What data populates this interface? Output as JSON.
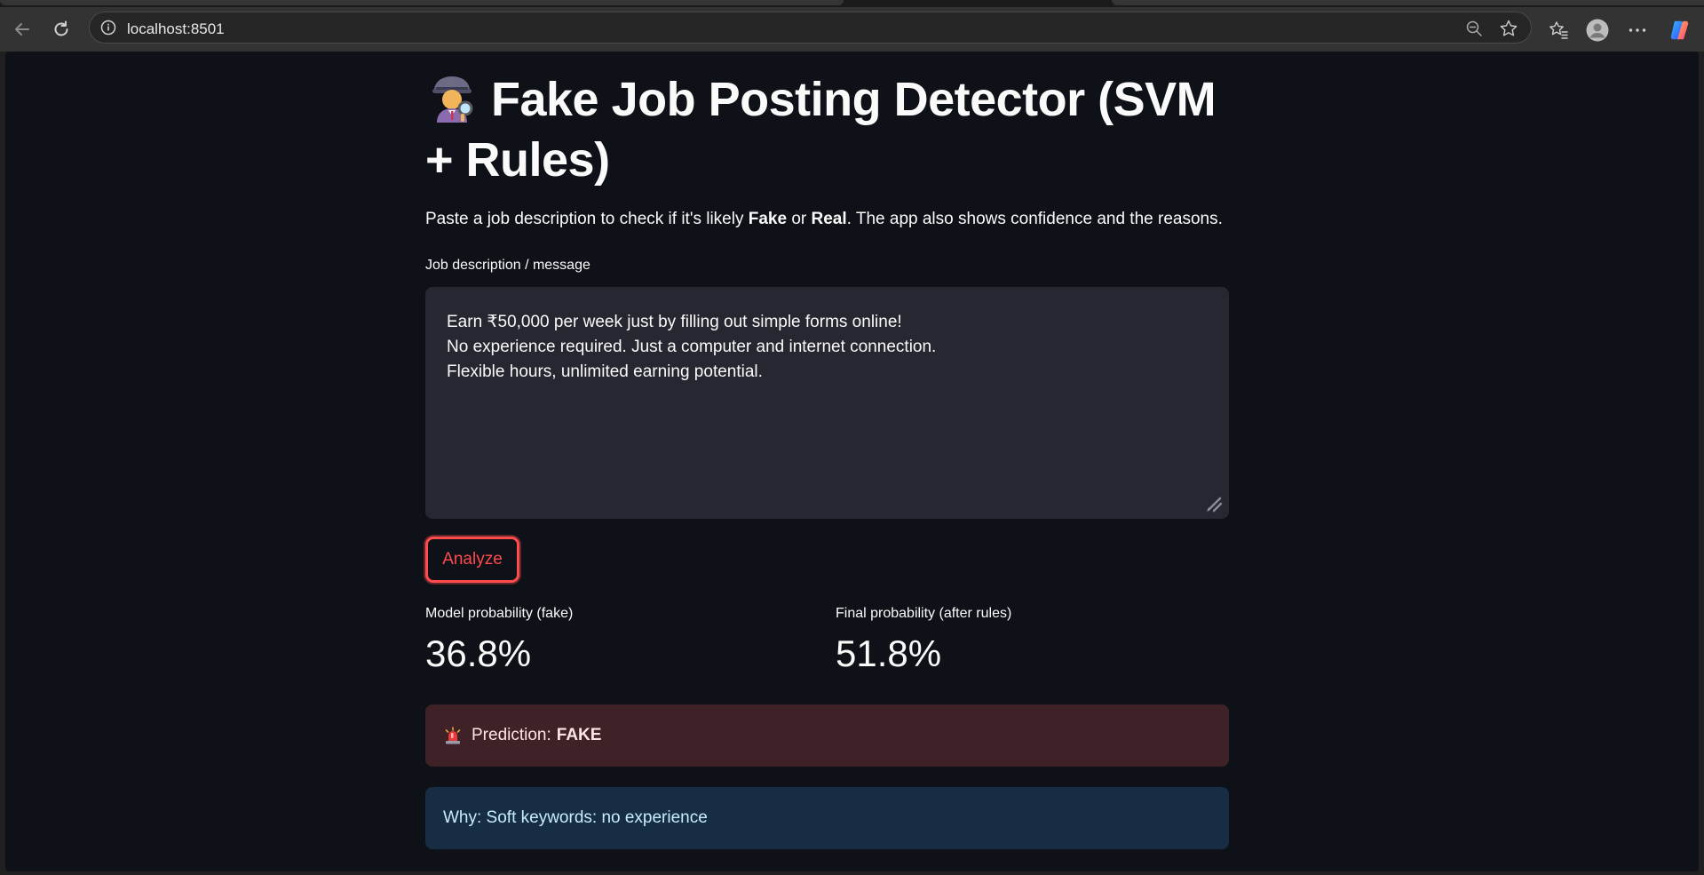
{
  "browser": {
    "url": "localhost:8501",
    "icons": [
      "back-icon",
      "reload-icon",
      "site-info-icon",
      "zoom-out-icon",
      "star-icon",
      "favorites-icon",
      "profile-icon",
      "more-icon",
      "copilot-icon"
    ]
  },
  "app": {
    "title": "Fake Job Posting Detector (SVM + Rules)",
    "title_emoji": "detective-icon",
    "subtitle_pre": "Paste a job description to check if it's likely ",
    "subtitle_fake": "Fake",
    "subtitle_or": " or ",
    "subtitle_real": "Real",
    "subtitle_post": ". The app also shows confidence and the reasons.",
    "textarea": {
      "label": "Job description / message",
      "value": "Earn ₹50,000 per week just by filling out simple forms online!\nNo experience required. Just a computer and internet connection.\nFlexible hours, unlimited earning potential."
    },
    "analyze_button": "Analyze",
    "metrics": [
      {
        "label": "Model probability (fake)",
        "value": "36.8%"
      },
      {
        "label": "Final probability (after rules)",
        "value": "51.8%"
      }
    ],
    "prediction": {
      "prefix": "Prediction:",
      "value": "FAKE"
    },
    "why": "Why: Soft keywords: no experience"
  },
  "colors": {
    "app_bg": "#0e1117",
    "accent": "#ff4b4b",
    "error_bg": "#3e2227",
    "info_bg": "#172d43",
    "textarea_bg": "#262730"
  }
}
